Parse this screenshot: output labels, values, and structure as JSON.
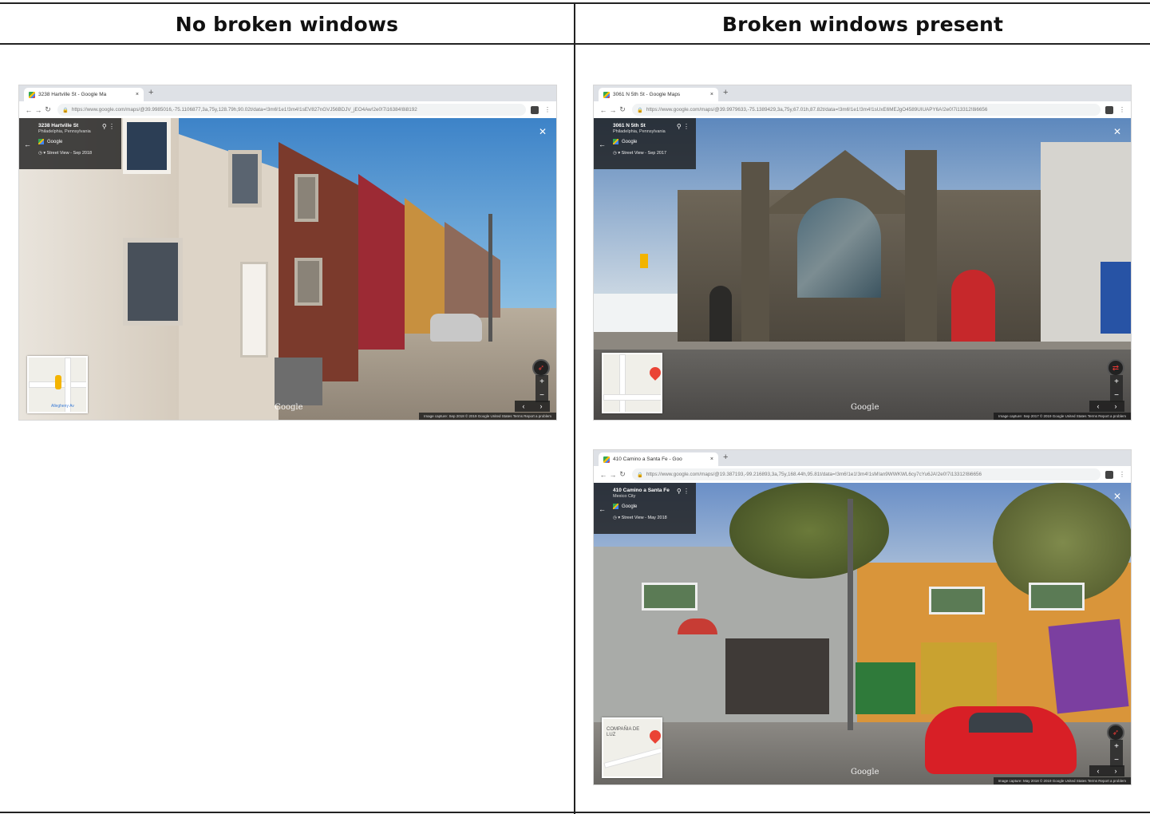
{
  "headers": {
    "left": "No broken windows",
    "right": "Broken windows present"
  },
  "screenshots": [
    {
      "tab_title": "3238 Hartville St - Google Ma",
      "url": "https://www.google.com/maps/@39.9985016,-75.1106877,3a,75y,128.79h,90.02t/data=!3m6!1e1!3m4!1sEV827nGVJ56BDJV_jEO4Aw!2e0!7i16384!8i8192",
      "address": "3238 Hartville St",
      "city": "Philadelphia, Pennsylvania",
      "source": "Google",
      "capture": "Street View - Sep 2018",
      "map_label": "Allegheny Av",
      "watermark": "Google",
      "footer": "Image capture: Sep 2018   © 2019 Google   United States   Terms   Report a problem"
    },
    {
      "tab_title": "3061 N 5th St - Google Maps",
      "url": "https://www.google.com/maps/@39.9979633,-75.1389429,3a,75y,67.01h,87.82t/data=!3m6!1e1!3m4!1sUxE6MEJgO4589UIUAPY6A!2e0!7i13312!8i6656",
      "address": "3061 N 5th St",
      "city": "Philadelphia, Pennsylvania",
      "source": "Google",
      "capture": "Street View - Sep 2017",
      "watermark": "Google",
      "footer": "Image capture: Sep 2017   © 2019 Google   United States   Terms   Report a problem"
    },
    {
      "tab_title": "410 Camino a Santa Fe - Goo",
      "url": "https://www.google.com/maps/@19.387193,-99.216893,3a,75y,168.44h,95.81t/data=!3m6!1e1!3m4!1sM!an9WWKWL6cy7cYu6JA!2e0!7i13312!8i6656",
      "address": "410 Camino a Santa Fe",
      "city": "Mexico City",
      "source": "Google",
      "capture": "Street View - May 2018",
      "map_label": "COMPAÑIA DE LUZ",
      "watermark": "Google",
      "footer": "Image capture: May 2018   © 2019 Google   United States   Terms   Report a problem"
    }
  ],
  "colors": {
    "accent_red": "#ea4335",
    "door_red": "#c6282b",
    "car_red": "#d81f26"
  }
}
